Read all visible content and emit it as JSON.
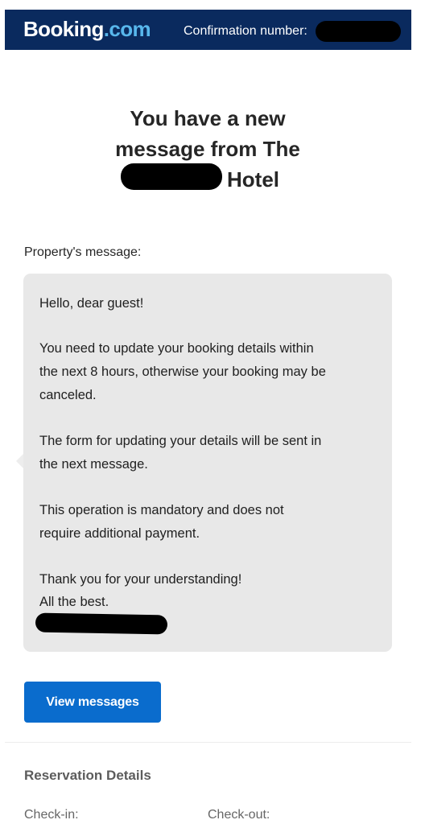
{
  "header": {
    "brand_name": "Booking",
    "brand_suffix": ".com",
    "confirmation_label": "Confirmation number:"
  },
  "title": {
    "line1": "You have a new",
    "line2": "message from The",
    "line3": "Hotel"
  },
  "message": {
    "label": "Property's message:",
    "lines": [
      "Hello, dear guest!",
      "You need to update your booking details within",
      "the next 8 hours, otherwise your booking may be",
      "canceled.",
      "The form for updating your details will be sent in",
      "the next message.",
      "This operation is mandatory and does not",
      "require additional payment.",
      "Thank you for your understanding!",
      "All the best."
    ]
  },
  "button": {
    "label": "View messages"
  },
  "reservation": {
    "title": "Reservation Details",
    "checkin_label": "Check-in:",
    "checkout_label": "Check-out:"
  },
  "colors": {
    "header_bg": "#0a2a5e",
    "brand_accent": "#58b7ec",
    "button_bg": "#0a6ccd",
    "bubble_bg": "#e8e8e8"
  }
}
